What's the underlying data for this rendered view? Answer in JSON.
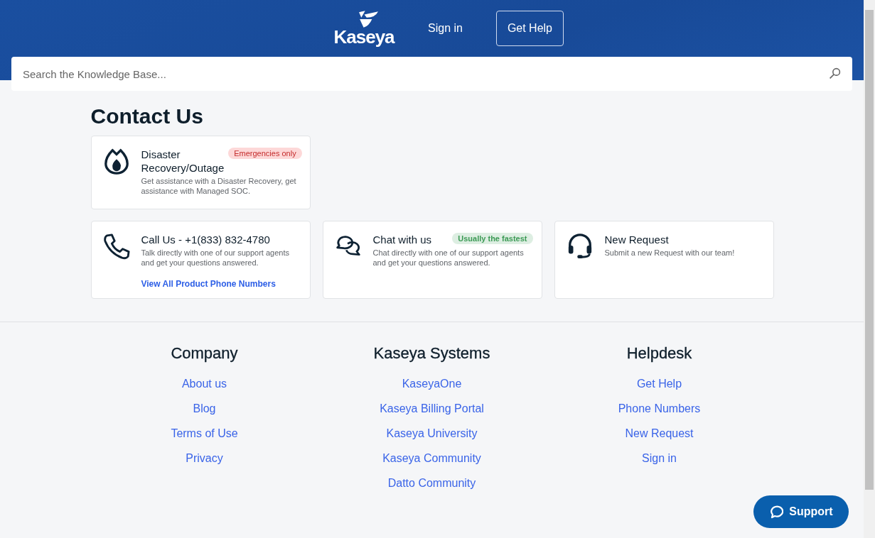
{
  "header": {
    "logo": "Kaseya",
    "sign_in": "Sign in",
    "get_help": "Get Help"
  },
  "search": {
    "placeholder": "Search the Knowledge Base..."
  },
  "page_title": "Contact Us",
  "cards": [
    {
      "kind": "flame",
      "title": "Disaster Recovery/Outage",
      "badge": {
        "text": "Emergencies only",
        "kind": "danger"
      },
      "description": "Get assistance with a Disaster Recovery, get assistance with Managed SOC."
    },
    {
      "kind": "phone",
      "title": "Call Us - +1(833) 832-4780",
      "description": "Talk directly with one of our support agents and get your questions answered.",
      "link": "View All Product Phone Numbers"
    },
    {
      "kind": "chat",
      "title": "Chat with us",
      "badge": {
        "text": "Usually the fastest",
        "kind": "success"
      },
      "description": "Chat directly with one of our support agents and get your questions answered."
    },
    {
      "kind": "headset",
      "title": "New Request",
      "description": "Submit a new Request with our team!"
    }
  ],
  "footer": [
    {
      "heading": "Company",
      "links": [
        "About us",
        "Blog",
        "Terms of Use",
        "Privacy"
      ]
    },
    {
      "heading": "Kaseya Systems",
      "links": [
        "KaseyaOne",
        "Kaseya Billing Portal",
        "Kaseya University",
        "Kaseya Community",
        "Datto Community"
      ]
    },
    {
      "heading": "Helpdesk",
      "links": [
        "Get Help",
        "Phone Numbers",
        "New Request",
        "Sign in"
      ]
    }
  ],
  "support_button": "Support"
}
